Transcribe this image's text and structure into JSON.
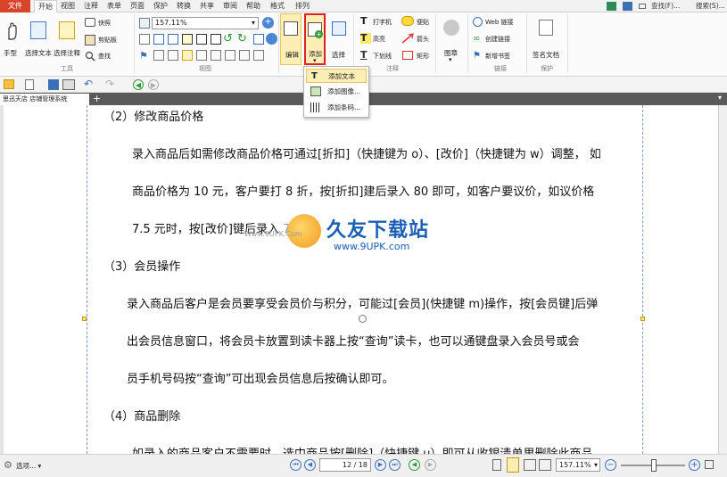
{
  "tabs": [
    "文件",
    "开始",
    "视图",
    "注释",
    "表单",
    "页面",
    "保护",
    "转换",
    "共享",
    "审阅",
    "帮助",
    "格式",
    "排列"
  ],
  "title_right": {
    "find": "查找(F)...",
    "search": "搜索(S)..."
  },
  "ribbon": {
    "tools": {
      "hand": "手型",
      "select_text": "选择文本",
      "select_note": "选择注释",
      "snapshot": "快照",
      "clipboard": "剪贴板",
      "find": "查找",
      "group": "工具"
    },
    "view": {
      "zoom": "157.11%",
      "group": "视图"
    },
    "edit": {
      "label": "编辑",
      "add": "添加",
      "select": "选择"
    },
    "comment": {
      "typewriter": "打字机",
      "note": "便贴",
      "highlight": "高亮",
      "arrow": "箭头",
      "underline": "下划线",
      "rect": "矩形",
      "group": "注释"
    },
    "stamp": {
      "label": "图章"
    },
    "links": {
      "web": "Web 链接",
      "create": "创建链接",
      "bookmark": "新增书签",
      "group": "链接"
    },
    "protect": {
      "sign": "签名文档",
      "group": "保护"
    }
  },
  "dropdown": {
    "items": [
      "添加文本",
      "添加图像...",
      "添加条码..."
    ]
  },
  "doc_tab": {
    "title": "思迅天店 店铺管理系统"
  },
  "document": {
    "lines": [
      "（2）修改商品价格",
      "录入商品后如需修改商品价格可通过[折扣]（快捷键为 o）、[改价]（快捷键为 w）调整， 如",
      "商品价格为 10 元，客户要打 8 折，按[折扣]建后录入 80 即可，如客户要议价，如议价格",
      "7.5 元时，按[改价]键后录入 7.5",
      "（3）会员操作",
      "录入商品后客户是会员要享受会员价与积分，可能过[会员](快捷键 m)操作，按[会员键]后弹",
      "出会员信息窗口，将会员卡放置到读卡器上按“查询”读卡，也可以通键盘录入会员号或会",
      "员手机号码按“查询”可出现会员信息后按确认即可。",
      "（4）商品删除",
      "如录入的商品客户不需要时，选中商品按[删除]（快捷键 u）即可从收银清单里删除此商品"
    ]
  },
  "watermark": {
    "title": "久友下载站",
    "url": "www.9UPK.com",
    "small": "Www.9UPK.Com"
  },
  "status": {
    "options": "选项...",
    "page": "12 / 18",
    "zoom": "157.11%"
  },
  "colors": {
    "accent": "#d9452b",
    "highlight_box": "#e02020",
    "watermark_orange": "#f29b1f"
  }
}
